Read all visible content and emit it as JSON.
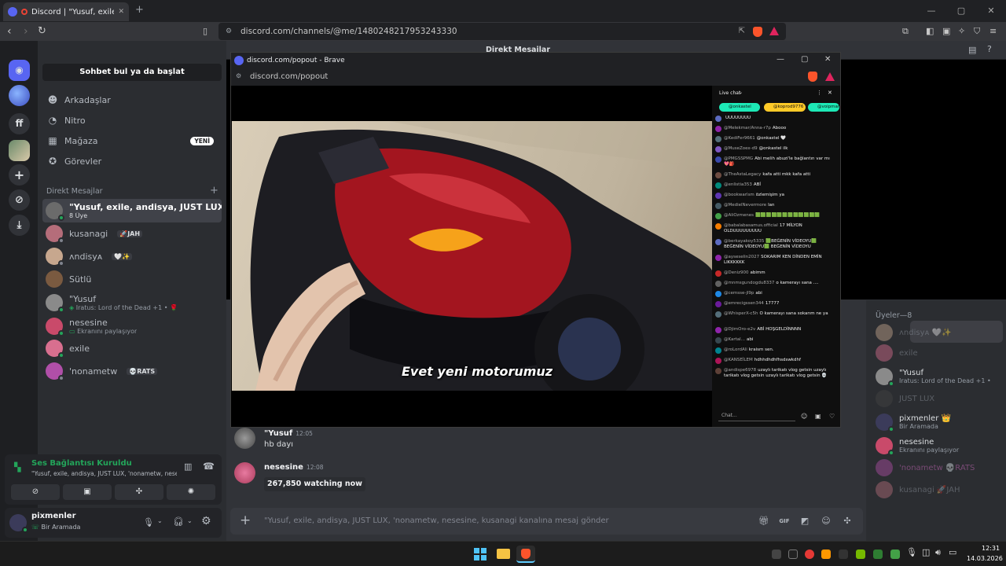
{
  "browser": {
    "tab_title": "Discord | \"Yusuf, exile, andisya",
    "url": "discord.com/channels/@me/1480248217953243330"
  },
  "window_controls": {
    "minimize": "—",
    "maximize": "▢",
    "close": "✕"
  },
  "discord_header": {
    "title": "Direkt Mesajlar"
  },
  "sidebar": {
    "search_label": "Sohbet bul ya da başlat",
    "nav": [
      {
        "label": "Arkadaşlar",
        "icon": "friends-icon"
      },
      {
        "label": "Nitro",
        "icon": "nitro-icon"
      },
      {
        "label": "Mağaza",
        "icon": "shop-icon",
        "badge": "YENİ"
      },
      {
        "label": "Görevler",
        "icon": "quests-icon"
      }
    ],
    "dm_header": "Direkt Mesajlar",
    "dms": [
      {
        "name": "\"Yusuf, exile, andisya, JUST LUX, 'nona...",
        "sub": "8 Üye",
        "color": "#6b6b6b"
      },
      {
        "name": "kusanagi",
        "tag": "🚀JAH",
        "color": "#b56d7a"
      },
      {
        "name": "ᴧndisyᴀ",
        "tag": "🤍✨",
        "color": "#c7a78e"
      },
      {
        "name": "Sütlü",
        "color": "#7a5a40"
      },
      {
        "name": "\"Yusuf",
        "sub": "Iratus: Lord of the Dead +1 • 🌹",
        "color": "#8a8a8a"
      },
      {
        "name": "nesesine",
        "sub": "Ekranını paylaşıyor",
        "color": "#c94a6a"
      },
      {
        "name": "exile",
        "color": "#d86f8f"
      },
      {
        "name": "'nonametw",
        "tag": "💀RATS",
        "color": "#b04fa8"
      }
    ]
  },
  "voice": {
    "status": "Ses Bağlantısı Kuruldu",
    "channel": "\"Yusuf, exile, andisya, JUST LUX, 'nonametw, nese..."
  },
  "user": {
    "name": "pixmenler",
    "status": "Bir Aramada"
  },
  "messages": [
    {
      "author": "\"Yusuf",
      "time": "12:05",
      "text": "hb dayı"
    },
    {
      "author": "nesesine",
      "time": "12:08",
      "embed": "267,850 watching now"
    }
  ],
  "composer": {
    "placeholder": "\"Yusuf, exile, andisya, JUST LUX, 'nonametw, nesesine, kusanagi kanalına mesaj gönder"
  },
  "members": {
    "header": "Üyeler—8",
    "list": [
      {
        "name": "ᴧndisyᴀ 🤍✨",
        "dim": true,
        "color": "#c7a78e"
      },
      {
        "name": "exile",
        "dim": true,
        "color": "#d86f8f"
      },
      {
        "name": "\"Yusuf",
        "sub": "Iratus: Lord of the Dead +1 •",
        "dim": false,
        "color": "#8a8a8a"
      },
      {
        "name": "JUST LUX",
        "dim": true,
        "color": "#444"
      },
      {
        "name": "pixmenler 👑",
        "sub": "Bir Aramada",
        "dim": false,
        "color": "#3b3b5a"
      },
      {
        "name": "nesesine",
        "sub": "Ekranını paylaşıyor",
        "dim": false,
        "color": "#c94a6a"
      },
      {
        "name": "'nonametw 💀RATS",
        "dim": true,
        "color": "#b04fa8"
      },
      {
        "name": "kusanagi 🚀JAH",
        "dim": true,
        "color": "#b56d7a"
      }
    ]
  },
  "popout": {
    "title": "discord.com/popout - Brave",
    "url": "discord.com/popout",
    "subtitle": "Evet yeni motorumuz"
  },
  "livechat": {
    "title": "Live chat",
    "pills": [
      "@onkastel",
      "@koprod9776",
      "@voipman"
    ],
    "messages": [
      {
        "user": "",
        "text": "UUUUUUUU"
      },
      {
        "user": "@Melekmar/Anna-r7p",
        "text": "Abooo"
      },
      {
        "user": "@KediFer9661",
        "text": "@onkastel 🤍"
      },
      {
        "user": "@MuseZoex-d9",
        "text": "@onkastel ilk"
      },
      {
        "user": "@PMGSSPMG",
        "text": "Abi melih abuzi'le bağlantın var mı 💖🎒"
      },
      {
        "user": "@TheAstaLegacy",
        "text": "kafa atti mkk kafa atti"
      },
      {
        "user": "@enlistia353",
        "text": "ABİ"
      },
      {
        "user": "@bookwarlsm",
        "text": "özlemişim ya"
      },
      {
        "user": "@MedielNevermore",
        "text": "lan"
      },
      {
        "user": "@AliOzmenes",
        "text": "🟩🟩🟩🟩🟩🟩🟩🟩🟩🟩🟩🟩"
      },
      {
        "user": "@babalabasamus.official",
        "text": "17 MİLYON OLDUUUUUUUUU"
      },
      {
        "user": "@berkayakoy5335",
        "text": "🟩BEĞENİN VİDEOYU🟩 BEĞENİN VİDEOYU🟩 BEĞENİN VİDEOYU"
      },
      {
        "user": "@ayseselin2027",
        "text": "SOKARIM KEN DİNDEN EMİN LIKKKKKK"
      },
      {
        "user": "@Deniz900",
        "text": "abimm"
      },
      {
        "user": "@mnmsgundogdu8337",
        "text": "o kamerayı sana ...."
      },
      {
        "user": "@cemsse-jl9p",
        "text": "abi"
      },
      {
        "user": "@emrecigssen344",
        "text": "17777"
      },
      {
        "user": "@WhisperX-c5h",
        "text": "O kamerayı sana sokarım ne ya"
      },
      {
        "user": "@DjimOro-e2v",
        "text": "ABİ HOŞGELDİNNNN"
      },
      {
        "user": "@Kartal...",
        "text": "abi"
      },
      {
        "user": "@roLordAli",
        "text": "kraism sen."
      },
      {
        "user": "@KANSEİLEM",
        "text": "hdhhdhdhfhsdswkdhf"
      },
      {
        "user": "@andispe6978",
        "text": "uzaylı tarikatı vlog getsin uzaylı tarikatı vlog getsin uzaylı tarikatı vlog getsin 💀"
      }
    ],
    "input_placeholder": "Chat..."
  },
  "taskbar": {
    "time": "12:31",
    "date": "14.03.2026"
  },
  "colors": {
    "accent": "#5865f2",
    "online": "#23a55a",
    "voice_green": "#23a55a"
  }
}
